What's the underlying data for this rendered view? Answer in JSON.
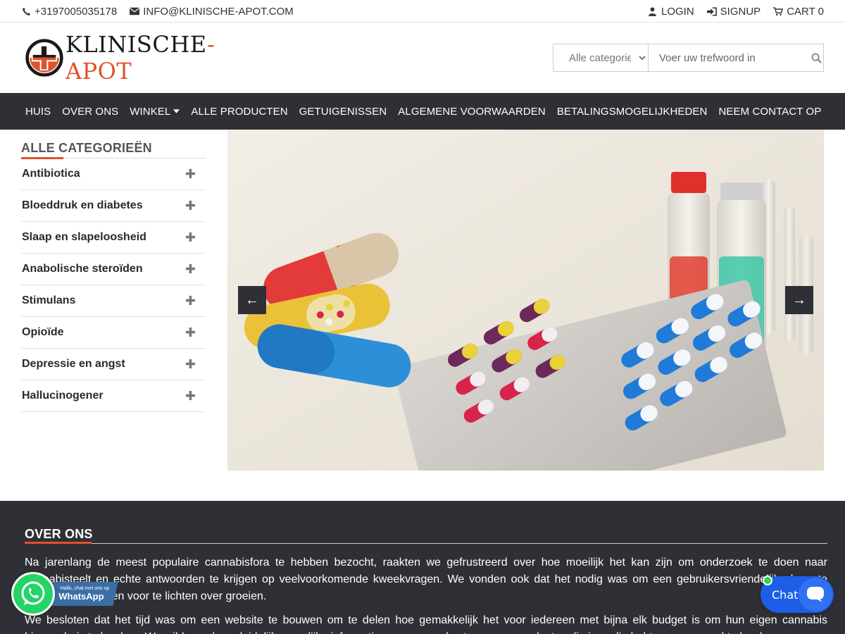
{
  "topbar": {
    "phone": "+3197005035178",
    "email": "INFO@KLINISCHE-APOT.COM",
    "login": "LOGIN",
    "signup": "SIGNUP",
    "cart": "CART 0"
  },
  "header": {
    "logo_text_main": "KLINISCHE",
    "logo_text_dash": "-",
    "logo_text_accent": "APOT",
    "search": {
      "category_selected": "Alle categorieën",
      "placeholder": "Voer uw trefwoord in"
    }
  },
  "nav": {
    "items": [
      {
        "label": "HUIS"
      },
      {
        "label": "OVER ONS"
      },
      {
        "label": "WINKEL"
      },
      {
        "label": "ALLE PRODUCTEN"
      },
      {
        "label": "GETUIGENISSEN"
      },
      {
        "label": "ALGEMENE VOORWAARDEN"
      },
      {
        "label": "BETALINGSMOGELIJKHEDEN"
      },
      {
        "label": "NEEM CONTACT OP"
      }
    ]
  },
  "sidebar": {
    "title": "ALLE CATEGORIEËN",
    "categories": [
      {
        "label": "Antibiotica"
      },
      {
        "label": "Bloeddruk en diabetes"
      },
      {
        "label": "Slaap en slapeloosheid"
      },
      {
        "label": "Anabolische steroïden"
      },
      {
        "label": "Stimulans"
      },
      {
        "label": "Opioïde"
      },
      {
        "label": "Depressie en angst"
      },
      {
        "label": "Hallucinogener"
      }
    ]
  },
  "slider": {
    "prev": "←",
    "next": "→"
  },
  "about": {
    "title": "OVER ONS",
    "p1": "Na jarenlang de meest populaire cannabisfora te hebben bezocht, raakten we gefrustreerd over hoe moeilijk het kan zijn om onderzoek te doen naar cannabisteelt en echte antwoorden te krijgen op veelvoorkomende kweekvragen. We vonden ook dat het nodig was om een gebruikersvriendelijke bron te hebben om mensen voor te lichten over groeien.",
    "p2": "We besloten dat het tijd was om een website te bouwen om te delen hoe gemakkelijk het voor iedereen met bijna elk budget is om hun eigen cannabis binnenshuis te kweken. We wilden ook zo duidelijk mogelijke informatie geven over de stappen en producten die je nodig hebt om succesvol te kweken."
  },
  "widgets": {
    "whatsapp_small": "Hallo, chat met ons op",
    "whatsapp_big": "WhatsApp",
    "chat_label": "Chat"
  }
}
